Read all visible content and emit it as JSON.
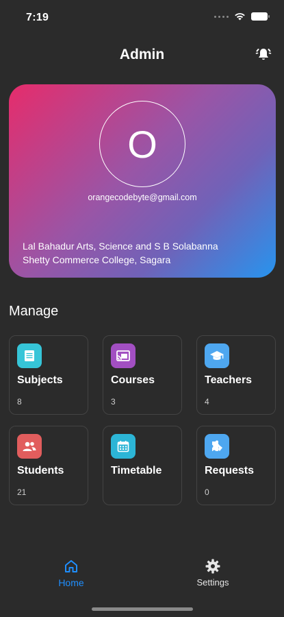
{
  "status_bar": {
    "time": "7:19"
  },
  "header": {
    "title": "Admin",
    "bell_icon": "bell-ring-icon"
  },
  "profile": {
    "avatar_letter": "O",
    "email": "orangecodebyte@gmail.com",
    "college_line1": "Lal Bahadur Arts, Science and S B Solabanna",
    "college_line2": "Shetty Commerce College, Sagara",
    "gradient": [
      "#e62c6b",
      "#9a55a6",
      "#2794ee"
    ]
  },
  "manage": {
    "title": "Manage",
    "tiles": [
      {
        "label": "Subjects",
        "count": "8",
        "icon": "list-icon",
        "color": "#36c5d8"
      },
      {
        "label": "Courses",
        "count": "3",
        "icon": "cast-icon",
        "color": "#a24fc2"
      },
      {
        "label": "Teachers",
        "count": "4",
        "icon": "graduation-cap-icon",
        "color": "#4ea7f0"
      },
      {
        "label": "Students",
        "count": "21",
        "icon": "users-icon",
        "color": "#e15d5d"
      },
      {
        "label": "Timetable",
        "count": "",
        "icon": "calendar-icon",
        "color": "#2cb5d6"
      },
      {
        "label": "Requests",
        "count": "0",
        "icon": "puzzle-icon",
        "color": "#4ea7f0"
      }
    ]
  },
  "bottom_nav": {
    "items": [
      {
        "label": "Home",
        "icon": "home-icon",
        "active": true,
        "color": "#1f8fff"
      },
      {
        "label": "Settings",
        "icon": "gear-icon",
        "active": false
      }
    ]
  }
}
